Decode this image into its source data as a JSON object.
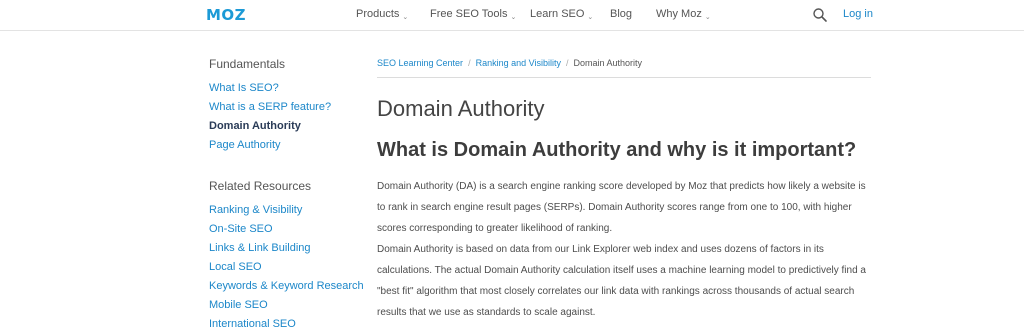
{
  "header": {
    "logo": "MOZ",
    "nav": [
      {
        "label": "Products",
        "dropdown": true
      },
      {
        "label": "Free SEO Tools",
        "dropdown": true
      },
      {
        "label": "Learn SEO",
        "dropdown": true
      },
      {
        "label": "Blog",
        "dropdown": false
      },
      {
        "label": "Why Moz",
        "dropdown": true
      }
    ],
    "chevron": "⌄",
    "login_label": "Log in"
  },
  "sidebar": {
    "fundamentals_heading": "Fundamentals",
    "fundamentals": [
      {
        "label": "What Is SEO?",
        "active": false
      },
      {
        "label": "What is a SERP feature?",
        "active": false
      },
      {
        "label": "Domain Authority",
        "active": true
      },
      {
        "label": "Page Authority",
        "active": false
      }
    ],
    "related_heading": "Related Resources",
    "related": [
      "Ranking & Visibility",
      "On-Site SEO",
      "Links & Link Building",
      "Local SEO",
      "Keywords & Keyword Research",
      "Mobile SEO",
      "International SEO"
    ]
  },
  "breadcrumb": {
    "items": [
      "SEO Learning Center",
      "Ranking and Visibility"
    ],
    "separator": "/",
    "current": "Domain Authority"
  },
  "main": {
    "title": "Domain Authority",
    "section_title": "What is Domain Authority and why is it important?",
    "paragraph1_lines": [
      "Domain Authority (DA) is a search engine ranking score developed by Moz that predicts how likely a website is",
      "to rank in search engine result pages (SERPs). Domain Authority scores range from one to 100, with higher",
      "scores corresponding to greater likelihood of ranking."
    ],
    "paragraph2_lines": [
      "Domain Authority is based on data from our Link Explorer web index and uses dozens of factors in its",
      "calculations. The actual Domain Authority calculation itself uses a machine learning model to predictively find a",
      "\"best fit\" algorithm that most closely correlates our link data with rankings across thousands of actual search",
      "results that we use as standards to scale against."
    ]
  },
  "colors": {
    "brand": "#1c9ad6",
    "link": "#1c87c9",
    "active_link": "#2a3b57",
    "text": "#4d4d4d"
  },
  "icons": {
    "search": "search-icon"
  }
}
